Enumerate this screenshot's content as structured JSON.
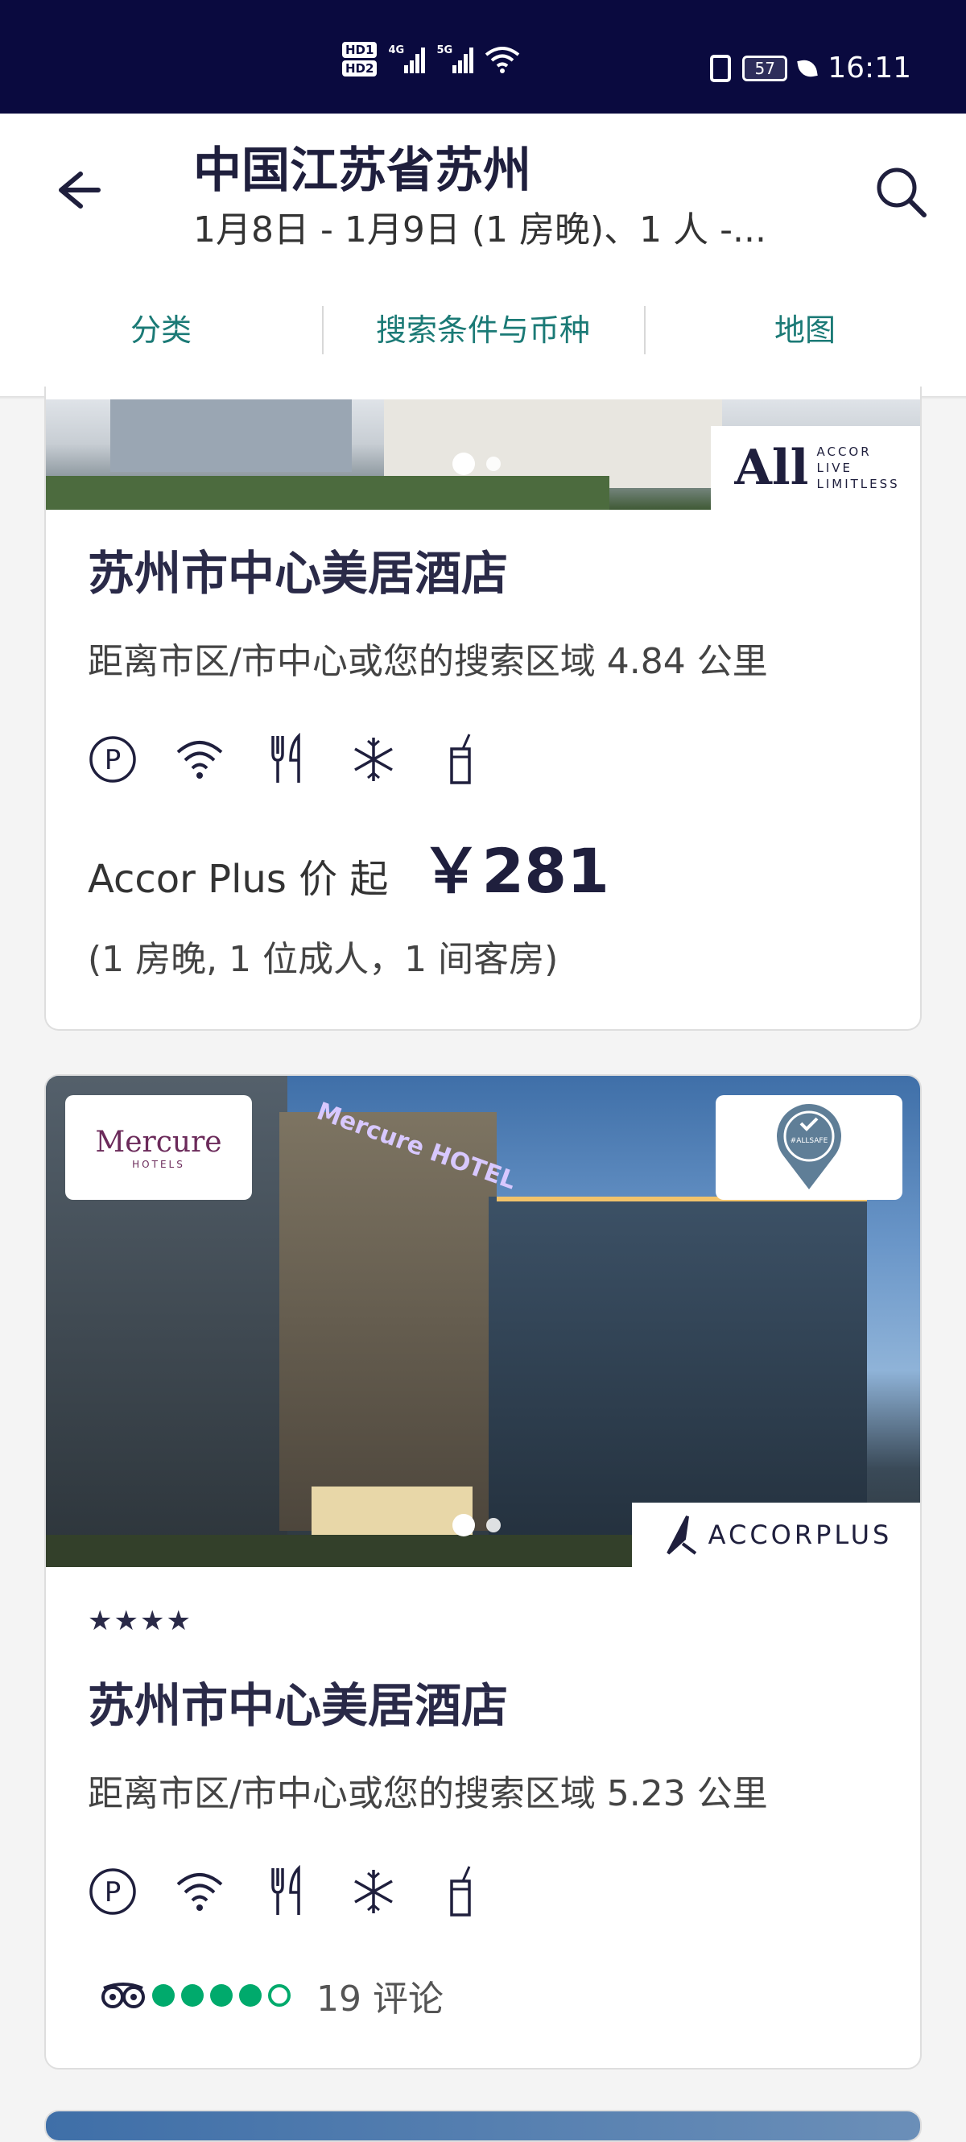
{
  "status_bar": {
    "time": "16:11",
    "battery": "57",
    "network_1": "4G",
    "network_2": "5G",
    "sim_labels": [
      "HD1",
      "HD2"
    ]
  },
  "header": {
    "title": "中国江苏省苏州",
    "subtitle": "1月8日 - 1月9日 (1 房晚)、1 人 -...",
    "tabs": [
      "分类",
      "搜索条件与币种",
      "地图"
    ]
  },
  "colors": {
    "accent_teal": "#1b7a76",
    "status_bar_navy": "#0a0a3f",
    "rating_green": "#00aa6c"
  },
  "hotels": [
    {
      "name": "苏州市中心美居酒店",
      "distance": "距离市区/市中心或您的搜索区域 4.84 公里",
      "amenities": [
        "parking-icon",
        "wifi-icon",
        "restaurant-icon",
        "air-conditioning-icon",
        "bar-icon"
      ],
      "price_label": "Accor Plus 价 起",
      "price": "￥281",
      "price_note": "(1 房晚, 1 位成人，1 间客房)",
      "badge": {
        "line1": "ACCOR",
        "line2": "LIVE",
        "line3": "LIMITLESS",
        "logo": "All"
      }
    },
    {
      "stars": "★★★★",
      "star_count": 4,
      "name": "苏州市中心美居酒店",
      "distance": "距离市区/市中心或您的搜索区域 5.23 公里",
      "amenities": [
        "parking-icon",
        "wifi-icon",
        "restaurant-icon",
        "air-conditioning-icon",
        "bar-icon"
      ],
      "brand_logo": {
        "name": "Mercure",
        "sub": "HOTELS"
      },
      "safety_badge": "#ALLSAFE",
      "accorplus_badge": "ACCORPLUS",
      "building_sign": "Mercure HOTEL",
      "rating_bubbles": 4,
      "rating_max": 5,
      "reviews": "19 评论"
    }
  ]
}
